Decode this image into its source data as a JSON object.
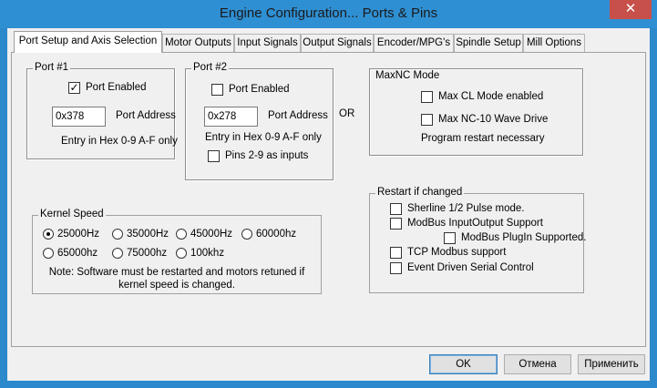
{
  "window": {
    "title": "Engine Configuration... Ports & Pins",
    "close_glyph": "✕"
  },
  "tabs": [
    {
      "label": "Port Setup and Axis Selection",
      "active": true
    },
    {
      "label": "Motor Outputs"
    },
    {
      "label": "Input Signals"
    },
    {
      "label": "Output Signals"
    },
    {
      "label": "Encoder/MPG's"
    },
    {
      "label": "Spindle Setup"
    },
    {
      "label": "Mill Options"
    }
  ],
  "port1": {
    "title": "Port #1",
    "enabled_label": "Port Enabled",
    "enabled": true,
    "address_value": "0x378",
    "address_label": "Port Address",
    "hint": "Entry in Hex 0-9 A-F only"
  },
  "port2": {
    "title": "Port #2",
    "enabled_label": "Port Enabled",
    "enabled": false,
    "address_value": "0x278",
    "address_label": "Port Address",
    "hint": "Entry in Hex 0-9 A-F only",
    "pins_label": "Pins 2-9 as inputs",
    "pins_checked": false
  },
  "or_label": "OR",
  "maxnc": {
    "title": "MaxNC Mode",
    "max_cl_label": "Max CL Mode enabled",
    "max_nc10_label": "Max NC-10 Wave Drive",
    "note": "Program restart necessary"
  },
  "kernel": {
    "title": "Kernel Speed",
    "options": [
      "25000Hz",
      "35000Hz",
      "45000Hz",
      "60000hz",
      "65000hz",
      "75000hz",
      "100khz"
    ],
    "selected": "25000Hz",
    "note_line1": "Note: Software must be restarted and motors retuned if",
    "note_line2": "kernel speed is changed."
  },
  "restart": {
    "title": "Restart if changed",
    "sherline": "Sherline 1/2 Pulse mode.",
    "modbus_io": "ModBus InputOutput Support",
    "modbus_plugin": "ModBus PlugIn Supported.",
    "tcp_modbus": "TCP Modbus support",
    "event_serial": "Event Driven Serial Control"
  },
  "buttons": {
    "ok": "OK",
    "cancel": "Отмена",
    "apply": "Применить"
  }
}
